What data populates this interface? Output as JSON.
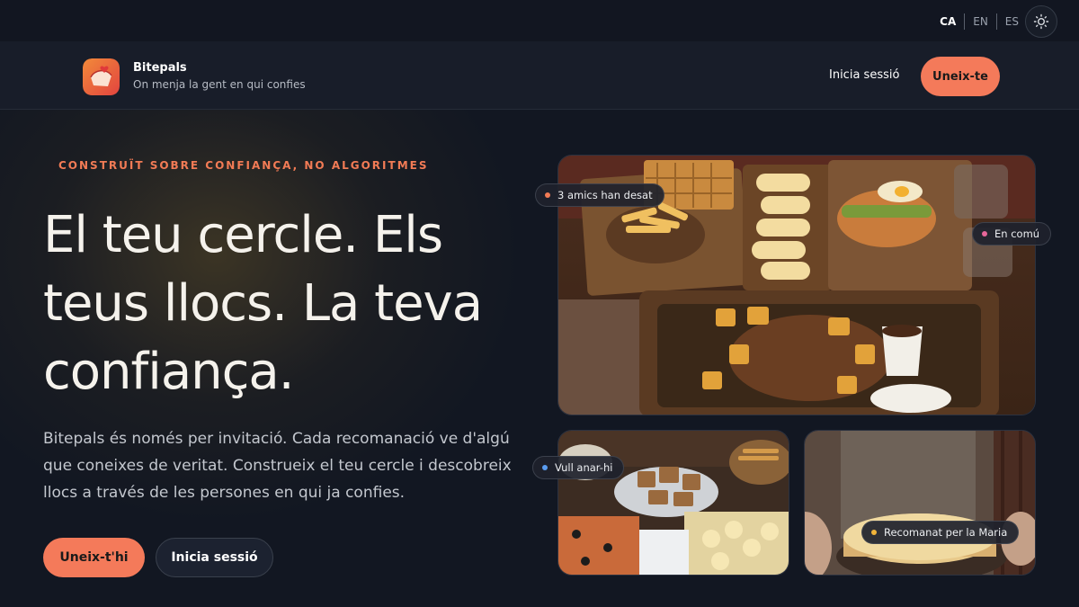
{
  "languages": [
    {
      "code": "CA",
      "active": true
    },
    {
      "code": "EN",
      "active": false
    },
    {
      "code": "ES",
      "active": false
    }
  ],
  "theme_toggle_icon": "sun-icon",
  "header": {
    "brand_name": "Bitepals",
    "tagline": "On menja la gent en qui confies",
    "login_label": "Inicia sessió",
    "join_label": "Uneix-te"
  },
  "hero": {
    "eyebrow": "CONSTRUÏT SOBRE CONFIANÇA, NO ALGORITMES",
    "headline": "El teu cercle. Els teus llocs. La teva confiança.",
    "description": "Bitepals és només per invitació. Cada recomanació ve d'algú que coneixes de veritat. Construeix el teu cercle i descobreix llocs a través de les persones en qui ja confies.",
    "primary_cta": "Uneix-t'hi",
    "secondary_cta": "Inicia sessió"
  },
  "photo_badges": [
    {
      "label": "3 amics han desat",
      "color": "#f27b55"
    },
    {
      "label": "En comú",
      "color": "#e8679a"
    },
    {
      "label": "Vull anar-hi",
      "color": "#5a9cf0"
    },
    {
      "label": "Recomanat per la Maria",
      "color": "#f2b43a"
    }
  ],
  "colors": {
    "accent": "#f47a5a",
    "background": "#121722",
    "header": "#181d29"
  }
}
